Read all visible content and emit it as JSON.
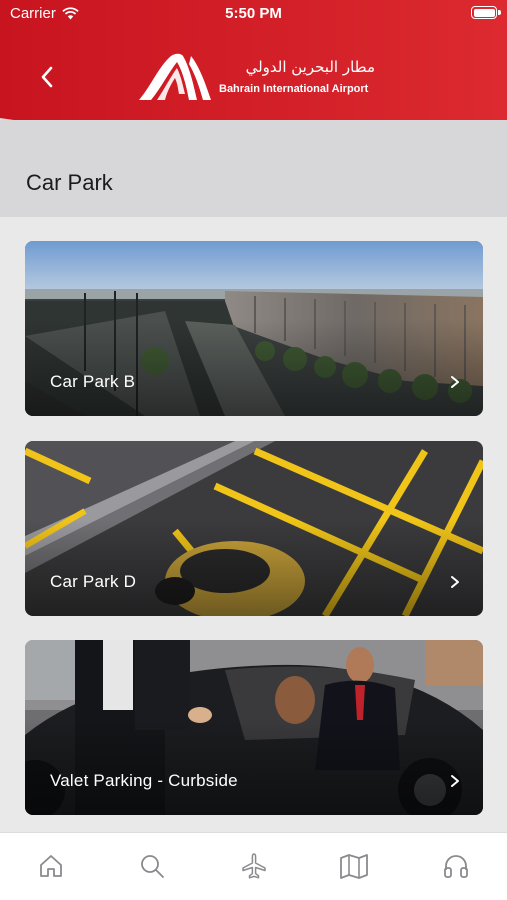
{
  "status_bar": {
    "carrier": "Carrier",
    "time": "5:50 PM"
  },
  "header": {
    "logo_arabic": "مطار البحرين الدولي",
    "logo_english": "Bahrain International Airport",
    "back_icon": "chevron-left-icon",
    "brand_color": "#d5202b"
  },
  "page": {
    "title": "Car Park"
  },
  "cards": [
    {
      "label": "Car Park B",
      "icon": "chevron-right-icon"
    },
    {
      "label": "Car Park D",
      "icon": "chevron-right-icon"
    },
    {
      "label": "Valet Parking - Curbside",
      "icon": "chevron-right-icon"
    }
  ],
  "tabbar": {
    "items": [
      {
        "icon": "home-icon"
      },
      {
        "icon": "search-icon"
      },
      {
        "icon": "airplane-icon"
      },
      {
        "icon": "map-icon"
      },
      {
        "icon": "headphones-icon"
      }
    ]
  }
}
